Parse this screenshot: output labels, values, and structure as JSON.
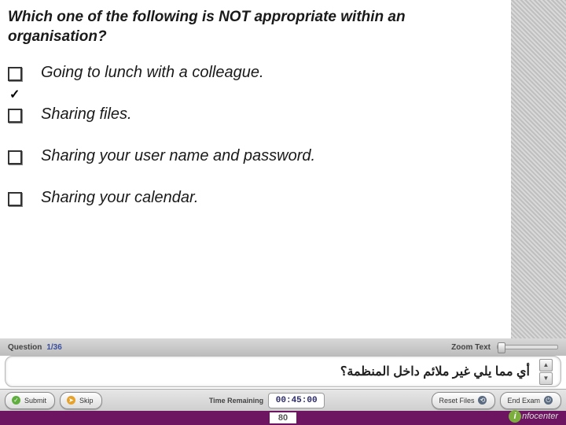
{
  "question": {
    "prompt": "Which one of the following is NOT appropriate within an organisation?",
    "options": [
      "Going to lunch with a colleague.",
      "Sharing files.",
      "Sharing your user name and password.",
      "Sharing your calendar."
    ]
  },
  "meta": {
    "question_label": "Question",
    "question_counter": "1/36",
    "zoom_label": "Zoom Text"
  },
  "translation": {
    "text": "أي مما يلي غير ملائم داخل المنظمة؟"
  },
  "toolbar": {
    "submit": "Submit",
    "skip": "Skip",
    "time_label": "Time Remaining",
    "time_value": "00:45:00",
    "reset": "Reset Files",
    "end": "End Exam"
  },
  "footer": {
    "page": "80",
    "brand": "nfocenter"
  }
}
